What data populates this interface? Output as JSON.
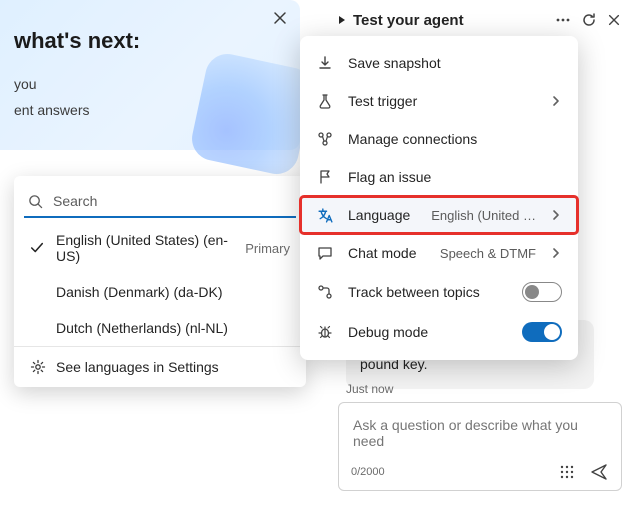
{
  "left": {
    "title": "what's next:",
    "line1": "you",
    "line2": "ent answers"
  },
  "langPanel": {
    "searchPlaceholder": "Search",
    "items": [
      {
        "label": "English (United States) (en-US)",
        "badge": "Primary",
        "checked": true
      },
      {
        "label": "Danish (Denmark) (da-DK)",
        "badge": "",
        "checked": false
      },
      {
        "label": "Dutch (Netherlands) (nl-NL)",
        "badge": "",
        "checked": false
      }
    ],
    "footer": "See languages in Settings"
  },
  "testHeader": {
    "title": "Test your agent"
  },
  "ctx": {
    "items": [
      {
        "icon": "download",
        "label": "Save snapshot",
        "value": "",
        "chevron": false,
        "toggle": null
      },
      {
        "icon": "flask",
        "label": "Test trigger",
        "value": "",
        "chevron": true,
        "toggle": null
      },
      {
        "icon": "connections",
        "label": "Manage connections",
        "value": "",
        "chevron": false,
        "toggle": null
      },
      {
        "icon": "flag",
        "label": "Flag an issue",
        "value": "",
        "chevron": false,
        "toggle": null
      },
      {
        "icon": "language",
        "label": "Language",
        "value": "English (United …",
        "chevron": true,
        "toggle": null,
        "highlighted": true
      },
      {
        "icon": "chat",
        "label": "Chat mode",
        "value": "Speech & DTMF",
        "chevron": true,
        "toggle": null
      },
      {
        "icon": "track",
        "label": "Track between topics",
        "value": "",
        "chevron": false,
        "toggle": "off"
      },
      {
        "icon": "bug",
        "label": "Debug mode",
        "value": "",
        "chevron": false,
        "toggle": "on"
      }
    ]
  },
  "chat": {
    "bubble": "To hear this menu again, press the pound key.",
    "time": "Just now",
    "placeholder": "Ask a question or describe what you need",
    "count": "0/2000"
  }
}
